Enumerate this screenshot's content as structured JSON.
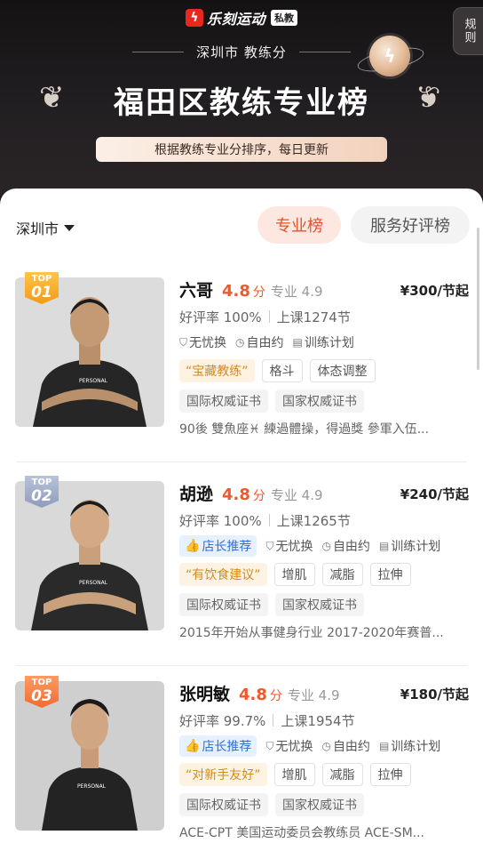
{
  "header": {
    "brand_icon": "bolt-icon",
    "brand_name": "乐刻运动",
    "brand_badge": "私教",
    "rules_label": "规则",
    "subtitle": "深圳市 教练分",
    "title": "福田区教练专业榜",
    "description": "根据教练专业分排序，每日更新"
  },
  "filter": {
    "city": "深圳市",
    "tabs": [
      {
        "label": "专业榜",
        "active": true
      },
      {
        "label": "服务好评榜",
        "active": false
      }
    ]
  },
  "coaches": [
    {
      "rank_label": "TOP",
      "rank": "01",
      "badge_color": "#f5a623",
      "name": "六哥",
      "score": "4.8",
      "score_unit": "分",
      "pro_score": "专业 4.9",
      "price": "¥300/节起",
      "rating": "好评率 100%",
      "lessons": "上课1274节",
      "manager_pick": "",
      "services": [
        "无忧换",
        "自由约",
        "训练计划"
      ],
      "highlight_tag": "“宝藏教练”",
      "tags": [
        "格斗",
        "体态调整"
      ],
      "certs": [
        "国际权威证书",
        "国家权威证书"
      ],
      "intro": "90後 雙魚座♓ 練過體操，得過獎 參軍入伍..."
    },
    {
      "rank_label": "TOP",
      "rank": "02",
      "badge_color": "#9aa6c4",
      "name": "胡逊",
      "score": "4.8",
      "score_unit": "分",
      "pro_score": "专业 4.9",
      "price": "¥240/节起",
      "rating": "好评率 100%",
      "lessons": "上课1265节",
      "manager_pick": "店长推荐",
      "services": [
        "无忧换",
        "自由约",
        "训练计划"
      ],
      "highlight_tag": "“有饮食建议”",
      "tags": [
        "增肌",
        "减脂",
        "拉伸"
      ],
      "certs": [
        "国际权威证书",
        "国家权威证书"
      ],
      "intro": "2015年开始从事健身行业 2017-2020年赛普..."
    },
    {
      "rank_label": "TOP",
      "rank": "03",
      "badge_color": "#f37a3f",
      "name": "张明敏",
      "score": "4.8",
      "score_unit": "分",
      "pro_score": "专业 4.9",
      "price": "¥180/节起",
      "rating": "好评率 99.7%",
      "lessons": "上课1954节",
      "manager_pick": "店长推荐",
      "services": [
        "无忧换",
        "自由约",
        "训练计划"
      ],
      "highlight_tag": "“对新手友好”",
      "tags": [
        "增肌",
        "减脂",
        "拉伸"
      ],
      "certs": [
        "国际权威证书",
        "国家权威证书"
      ],
      "intro": "ACE-CPT 美国运动委员会教练员 ACE-SM..."
    }
  ],
  "colors": {
    "accent": "#ee5a2c",
    "header_bg": "#1f1c1e",
    "manager_tag_blue": "#2f6fd6"
  }
}
